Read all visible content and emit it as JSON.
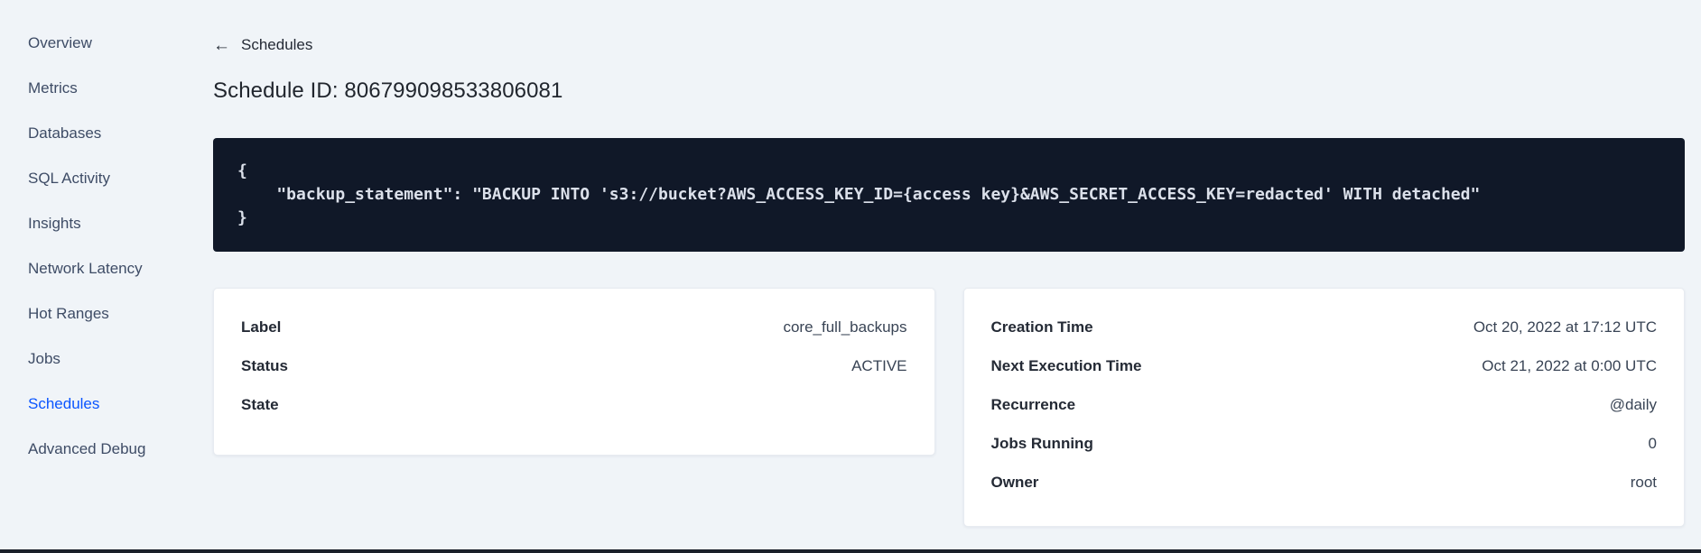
{
  "sidebar": {
    "items": [
      {
        "label": "Overview",
        "active": false
      },
      {
        "label": "Metrics",
        "active": false
      },
      {
        "label": "Databases",
        "active": false
      },
      {
        "label": "SQL Activity",
        "active": false
      },
      {
        "label": "Insights",
        "active": false
      },
      {
        "label": "Network Latency",
        "active": false
      },
      {
        "label": "Hot Ranges",
        "active": false
      },
      {
        "label": "Jobs",
        "active": false
      },
      {
        "label": "Schedules",
        "active": true
      },
      {
        "label": "Advanced Debug",
        "active": false
      }
    ]
  },
  "main": {
    "back_arrow": "←",
    "back_link": "Schedules",
    "page_title": "Schedule ID: 806799098533806081",
    "code_block": {
      "line0": "{",
      "line1": "    \"backup_statement\": \"BACKUP INTO 's3://bucket?AWS_ACCESS_KEY_ID={access key}&AWS_SECRET_ACCESS_KEY=redacted' WITH detached\"",
      "line2": "}"
    },
    "schedule_details": {
      "rows": [
        {
          "label": "Label",
          "value": "core_full_backups"
        },
        {
          "label": "Status",
          "value": "ACTIVE"
        },
        {
          "label": "State",
          "value": ""
        }
      ]
    },
    "execution_details": {
      "rows": [
        {
          "label": "Creation Time",
          "value": "Oct 20, 2022 at 17:12 UTC"
        },
        {
          "label": "Next Execution Time",
          "value": "Oct 21, 2022 at 0:00 UTC"
        },
        {
          "label": "Recurrence",
          "value": "@daily"
        },
        {
          "label": "Jobs Running",
          "value": "0"
        },
        {
          "label": "Owner",
          "value": "root"
        }
      ]
    }
  },
  "colors": {
    "background": "#f0f4f8",
    "accent_blue": "#0a55ff",
    "code_background": "#101828",
    "code_text": "#dbe0ea",
    "text_dark": "#242a35",
    "text_body": "#394455"
  }
}
